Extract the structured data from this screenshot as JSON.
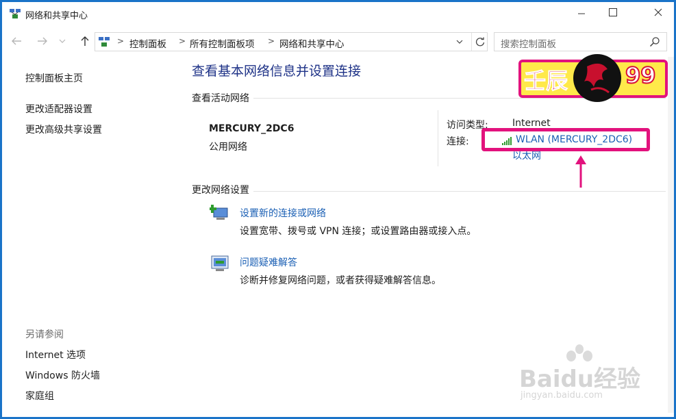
{
  "window": {
    "title": "网络和共享中心",
    "controls": {
      "minimize": "minimize-icon",
      "maximize": "maximize-icon",
      "close": "close-icon"
    }
  },
  "address": {
    "crumbs": [
      "控制面板",
      "所有控制面板项",
      "网络和共享中心"
    ],
    "search_placeholder": "搜索控制面板"
  },
  "left_pane": {
    "links": [
      "控制面板主页",
      "更改适配器设置",
      "更改高级共享设置"
    ],
    "see_also_heading": "另请参阅",
    "see_also": [
      "Internet 选项",
      "Windows 防火墙",
      "家庭组"
    ]
  },
  "main": {
    "title": "查看基本网络信息并设置连接",
    "active_networks_heading": "查看活动网络",
    "network": {
      "name": "MERCURY_2DC6",
      "type": "公用网络",
      "access_type_label": "访问类型:",
      "access_type_value": "Internet",
      "connections_label": "连接:",
      "connections": [
        "WLAN (MERCURY_2DC6)",
        "以太网"
      ]
    },
    "change_settings_heading": "更改网络设置",
    "tasks": [
      {
        "link": "设置新的连接或网络",
        "desc": "设置宽带、拨号或 VPN 连接；或设置路由器或接入点。"
      },
      {
        "link": "问题疑难解答",
        "desc": "诊断并修复网络问题，或者获得疑难解答信息。"
      }
    ]
  },
  "overlay": {
    "logo_left": "壬辰",
    "logo_right": "99",
    "watermark_main": "Baidu经验",
    "watermark_sub": "jingyan.baidu.com"
  },
  "colors": {
    "link": "#1a5fb4",
    "title": "#1e3287",
    "highlight": "#e2127d",
    "frame": "#1a73c8"
  }
}
